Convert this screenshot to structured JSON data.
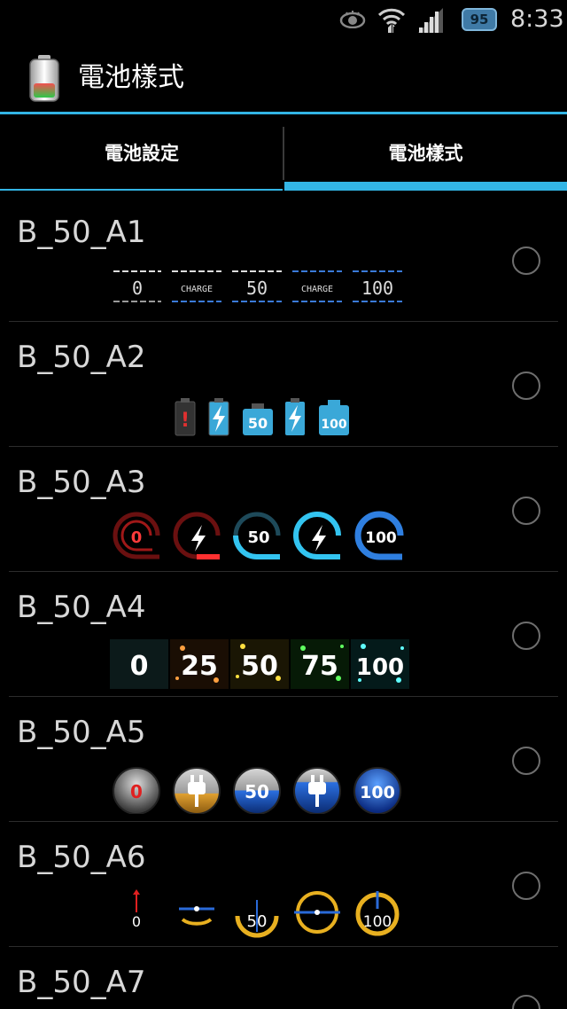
{
  "status_bar": {
    "time": "8:33",
    "battery_badge": "95",
    "icons": [
      "eye-icon",
      "wifi-icon",
      "signal-icon",
      "battery-badge-icon"
    ]
  },
  "action_bar": {
    "title": "電池樣式",
    "icon": "battery-app-icon"
  },
  "tabs": [
    {
      "label": "電池設定",
      "selected": false
    },
    {
      "label": "電池樣式",
      "selected": true
    }
  ],
  "colors": {
    "accent": "#33b5e5",
    "background": "#000000",
    "text": "#d8d8d8"
  },
  "styles": [
    {
      "name": "B_50_A1",
      "preview": [
        "0",
        "CHARGE",
        "50",
        "CHARGE",
        "100"
      ]
    },
    {
      "name": "B_50_A2",
      "preview": [
        "!",
        "bolt",
        "50",
        "bolt",
        "100"
      ]
    },
    {
      "name": "B_50_A3",
      "preview": [
        "0",
        "bolt",
        "50",
        "bolt",
        "100"
      ]
    },
    {
      "name": "B_50_A4",
      "preview": [
        "0",
        "25",
        "50",
        "75",
        "100"
      ]
    },
    {
      "name": "B_50_A5",
      "preview": [
        "0",
        "plug",
        "50",
        "plug",
        "100"
      ]
    },
    {
      "name": "B_50_A6",
      "preview": [
        "0",
        "bar",
        "50",
        "bar",
        "100"
      ]
    },
    {
      "name": "B_50_A7",
      "preview": []
    }
  ]
}
